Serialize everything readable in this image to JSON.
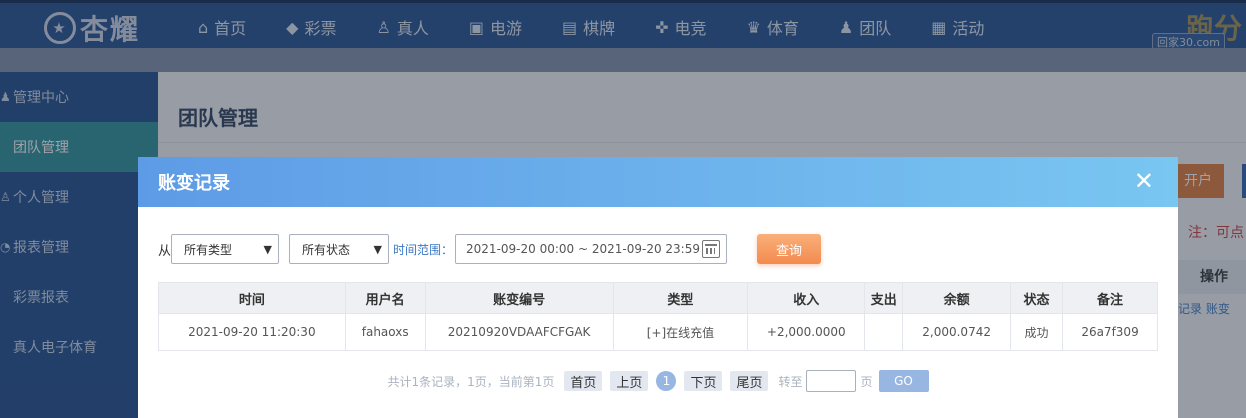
{
  "topnav": {
    "logo_text": "杏耀",
    "items": [
      {
        "label": "首页",
        "icon": "home-icon"
      },
      {
        "label": "彩票",
        "icon": "lottery-icon"
      },
      {
        "label": "真人",
        "icon": "live-dealer-icon"
      },
      {
        "label": "电游",
        "icon": "slot-machine-icon"
      },
      {
        "label": "棋牌",
        "icon": "cards-icon"
      },
      {
        "label": "电竞",
        "icon": "gamepad-icon"
      },
      {
        "label": "体育",
        "icon": "trophy-icon"
      },
      {
        "label": "团队",
        "icon": "team-icon"
      },
      {
        "label": "活动",
        "icon": "gift-icon"
      }
    ],
    "brand_right_big": "跑分",
    "brand_right_small": "回家30.com"
  },
  "sidebar": {
    "items": [
      {
        "label": "管理中心",
        "icon": "users-icon"
      },
      {
        "label": "团队管理",
        "active": true
      },
      {
        "label": "个人管理",
        "icon": "user-icon"
      },
      {
        "label": "报表管理",
        "icon": "report-icon"
      },
      {
        "label": "彩票报表"
      },
      {
        "label": "真人电子体育"
      }
    ]
  },
  "main": {
    "title": "团队管理",
    "peek_button": "开户",
    "peek_note": "注：可点",
    "peek_header": "操作",
    "peek_links": "记录  账变"
  },
  "modal": {
    "title": "账变记录",
    "close_label": "✕",
    "filters": {
      "from_label": "从",
      "type_select": "所有类型",
      "status_select": "所有状态",
      "range_label": "时间范围：",
      "date_range": "2021-09-20 00:00 ~ 2021-09-20 23:59",
      "query_button": "查询"
    },
    "table": {
      "headers": [
        "时间",
        "用户名",
        "账变编号",
        "类型",
        "收入",
        "支出",
        "余额",
        "状态",
        "备注"
      ],
      "rows": [
        [
          "2021-09-20 11:20:30",
          "fahaoxs",
          "20210920VDAAFCFGAK",
          "[+]在线充值",
          "+2,000.0000",
          "",
          "2,000.0742",
          "成功",
          "26a7f309"
        ]
      ]
    },
    "pager": {
      "summary": "共计1条记录，1页，当前第1页",
      "first": "首页",
      "prev": "上页",
      "current": "1",
      "next": "下页",
      "last": "尾页",
      "goto_label": "转至",
      "page_unit": "页",
      "go_button": "GO"
    }
  }
}
